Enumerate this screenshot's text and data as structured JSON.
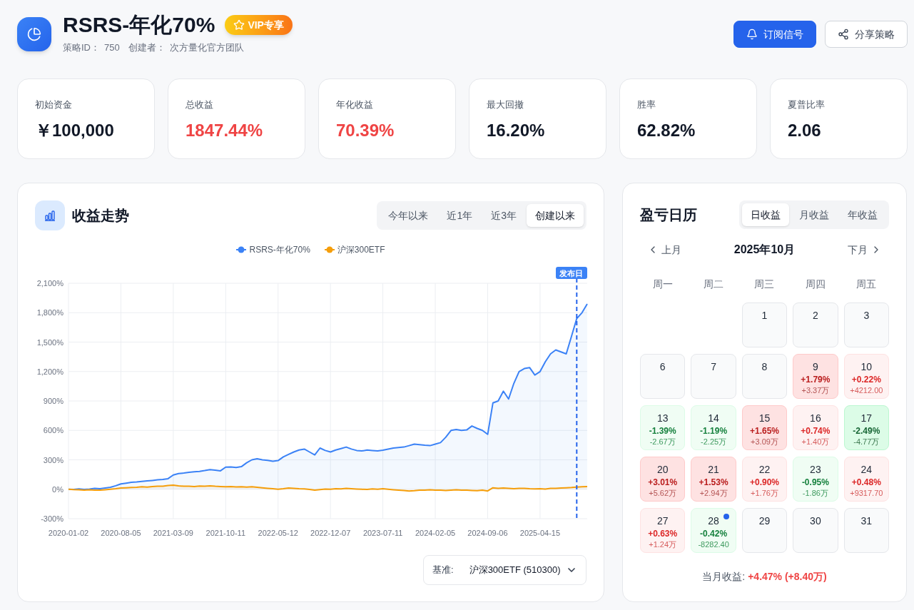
{
  "header": {
    "title": "RSRS-年化70%",
    "badge": "VIP专享",
    "meta": [
      {
        "label": "策略ID：",
        "value": "750"
      },
      {
        "label": "创建者：",
        "value": "次方量化官方团队"
      }
    ],
    "actions": [
      {
        "label": "订阅信号",
        "kind": "primary"
      },
      {
        "label": "分享策略",
        "kind": "secondary"
      }
    ]
  },
  "stats": [
    {
      "label": "初始资金",
      "value": "￥100,000",
      "kind": "plain"
    },
    {
      "label": "总收益",
      "value": "1847.44%",
      "kind": "gain"
    },
    {
      "label": "年化收益",
      "value": "70.39%",
      "kind": "gain"
    },
    {
      "label": "最大回撤",
      "value": "16.20%",
      "kind": "plain"
    },
    {
      "label": "胜率",
      "value": "62.82%",
      "kind": "plain"
    },
    {
      "label": "夏普比率",
      "value": "2.06",
      "kind": "plain"
    }
  ],
  "performance": {
    "title": "收益走势",
    "tabs": [
      {
        "label": "今年以来",
        "selected": false
      },
      {
        "label": "近1年",
        "selected": false
      },
      {
        "label": "近3年",
        "selected": false
      },
      {
        "label": "创建以来",
        "selected": true
      }
    ],
    "chart_data": {
      "type": "area",
      "categories": [
        "2020-01-02",
        null,
        null,
        null,
        null,
        null,
        null,
        null,
        null,
        null,
        "2020-08-05",
        null,
        null,
        null,
        null,
        null,
        null,
        null,
        null,
        null,
        "2021-03-09",
        null,
        null,
        null,
        null,
        null,
        null,
        null,
        null,
        null,
        "2021-10-11",
        null,
        null,
        null,
        null,
        null,
        null,
        null,
        null,
        null,
        "2022-05-12",
        null,
        null,
        null,
        null,
        null,
        null,
        null,
        null,
        null,
        "2022-12-07",
        null,
        null,
        null,
        null,
        null,
        null,
        null,
        null,
        null,
        "2023-07-11",
        null,
        null,
        null,
        null,
        null,
        null,
        null,
        null,
        null,
        "2024-02-05",
        null,
        null,
        null,
        null,
        null,
        null,
        null,
        null,
        null,
        "2024-09-06",
        null,
        null,
        null,
        null,
        null,
        null,
        null,
        null,
        null,
        "2025-04-15",
        null,
        null,
        null,
        null,
        null,
        null,
        null,
        null,
        null
      ],
      "series": [
        {
          "name": "RSRS-年化70%",
          "color": "#3b82f6",
          "values": [
            0,
            -2,
            3,
            -1,
            2,
            8,
            5,
            12,
            20,
            35,
            55,
            62,
            70,
            74,
            80,
            85,
            90,
            96,
            100,
            108,
            145,
            160,
            165,
            172,
            178,
            182,
            190,
            200,
            195,
            188,
            225,
            228,
            222,
            230,
            270,
            300,
            310,
            300,
            295,
            285,
            292,
            330,
            355,
            380,
            400,
            410,
            380,
            350,
            420,
            395,
            380,
            400,
            415,
            430,
            410,
            395,
            390,
            400,
            395,
            392,
            398,
            410,
            420,
            425,
            430,
            445,
            460,
            455,
            448,
            445,
            460,
            475,
            530,
            600,
            610,
            600,
            605,
            645,
            620,
            600,
            560,
            880,
            900,
            1000,
            920,
            1080,
            1200,
            1230,
            1240,
            1165,
            1200,
            1300,
            1380,
            1420,
            1400,
            1380,
            1560,
            1740,
            1800,
            1890
          ]
        },
        {
          "name": "沪深300ETF",
          "color": "#f59e0b",
          "values": [
            0,
            -3,
            -5,
            -8,
            -6,
            -10,
            -8,
            -5,
            0,
            5,
            12,
            15,
            18,
            20,
            25,
            22,
            28,
            30,
            32,
            38,
            42,
            35,
            30,
            32,
            28,
            33,
            30,
            35,
            30,
            28,
            25,
            27,
            24,
            26,
            22,
            25,
            20,
            15,
            10,
            5,
            0,
            5,
            12,
            8,
            5,
            3,
            -2,
            -8,
            -3,
            2,
            0,
            5,
            3,
            8,
            5,
            2,
            0,
            -2,
            3,
            0,
            5,
            0,
            -5,
            -8,
            -12,
            -18,
            -15,
            -10,
            -8,
            -5,
            -8,
            -10,
            -12,
            -8,
            -5,
            -8,
            -10,
            -12,
            -15,
            -10,
            -18,
            15,
            8,
            12,
            10,
            5,
            8,
            10,
            5,
            3,
            5,
            2,
            8,
            10,
            12,
            15,
            18,
            22,
            25,
            28
          ]
        }
      ],
      "ylim": [
        -300,
        2100
      ],
      "yticks": [
        {
          "value": 2100,
          "label": "2,100%"
        },
        {
          "value": 1800,
          "label": "1,800%"
        },
        {
          "value": 1500,
          "label": "1,500%"
        },
        {
          "value": 1200,
          "label": "1,200%"
        },
        {
          "value": 900,
          "label": "900%"
        },
        {
          "value": 600,
          "label": "600%"
        },
        {
          "value": 300,
          "label": "300%"
        },
        {
          "value": 0,
          "label": "0%"
        },
        {
          "value": -300,
          "label": "-300%"
        }
      ],
      "grid": true,
      "legend": "top",
      "annotations": [
        "发布日"
      ]
    },
    "benchmark": {
      "label": "基准:",
      "value": "沪深300ETF (510300)"
    }
  },
  "calendar": {
    "title": "盈亏日历",
    "tabs": [
      {
        "label": "日收益",
        "selected": true
      },
      {
        "label": "月收益",
        "selected": false
      },
      {
        "label": "年收益",
        "selected": false
      }
    ],
    "prev": "上月",
    "month": "2025年10月",
    "next": "下月",
    "weekdays": [
      "周一",
      "周二",
      "周三",
      "周四",
      "周五"
    ],
    "weeks": [
      [
        {
          "kind": "blank"
        },
        {
          "kind": "blank"
        },
        {
          "kind": "flat",
          "day": "1",
          "today": false
        },
        {
          "kind": "flat",
          "day": "2",
          "today": false
        },
        {
          "kind": "flat",
          "day": "3",
          "today": false
        }
      ],
      [
        {
          "kind": "flat",
          "day": "6",
          "today": false
        },
        {
          "kind": "flat",
          "day": "7",
          "today": false
        },
        {
          "kind": "flat",
          "day": "8",
          "today": false
        },
        {
          "kind": "gain",
          "day": "9",
          "change": "+1.79%",
          "profit": "+3.37万",
          "strong": true,
          "today": false
        },
        {
          "kind": "gain",
          "day": "10",
          "change": "+0.22%",
          "profit": "+4212.00",
          "strong": false,
          "today": false
        }
      ],
      [
        {
          "kind": "loss",
          "day": "13",
          "change": "-1.39%",
          "profit": "-2.67万",
          "strong": false,
          "today": false
        },
        {
          "kind": "loss",
          "day": "14",
          "change": "-1.19%",
          "profit": "-2.25万",
          "strong": false,
          "today": false
        },
        {
          "kind": "gain",
          "day": "15",
          "change": "+1.65%",
          "profit": "+3.09万",
          "strong": true,
          "today": false
        },
        {
          "kind": "gain",
          "day": "16",
          "change": "+0.74%",
          "profit": "+1.40万",
          "strong": false,
          "today": false
        },
        {
          "kind": "loss",
          "day": "17",
          "change": "-2.49%",
          "profit": "-4.77万",
          "strong": true,
          "today": false
        }
      ],
      [
        {
          "kind": "gain",
          "day": "20",
          "change": "+3.01%",
          "profit": "+5.62万",
          "strong": true,
          "today": false
        },
        {
          "kind": "gain",
          "day": "21",
          "change": "+1.53%",
          "profit": "+2.94万",
          "strong": true,
          "today": false
        },
        {
          "kind": "gain",
          "day": "22",
          "change": "+0.90%",
          "profit": "+1.76万",
          "strong": false,
          "today": false
        },
        {
          "kind": "loss",
          "day": "23",
          "change": "-0.95%",
          "profit": "-1.86万",
          "strong": false,
          "today": false
        },
        {
          "kind": "gain",
          "day": "24",
          "change": "+0.48%",
          "profit": "+9317.70",
          "strong": false,
          "today": false
        }
      ],
      [
        {
          "kind": "gain",
          "day": "27",
          "change": "+0.63%",
          "profit": "+1.24万",
          "strong": false,
          "today": false
        },
        {
          "kind": "loss",
          "day": "28",
          "change": "-0.42%",
          "profit": "-8282.40",
          "strong": false,
          "today": true
        },
        {
          "kind": "flat",
          "day": "29",
          "today": false
        },
        {
          "kind": "flat",
          "day": "30",
          "today": false
        },
        {
          "kind": "flat",
          "day": "31",
          "today": false
        }
      ]
    ],
    "summary": {
      "label": "当月收益:",
      "value": "+4.47% (+8.40万)",
      "kind": "gain"
    }
  }
}
